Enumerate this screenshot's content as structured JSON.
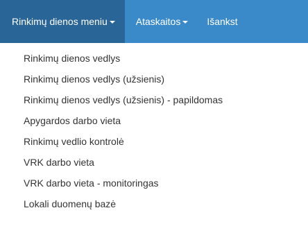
{
  "navbar": {
    "items": [
      {
        "label": "Rinkimų dienos meniu"
      },
      {
        "label": "Ataskaitos"
      },
      {
        "label": "Išankst"
      }
    ],
    "colors": {
      "background": "#3a8ac9",
      "active_background": "#2a6597",
      "text": "#ffffff"
    }
  },
  "dropdown": {
    "items": [
      {
        "label": "Rinkimų dienos vedlys"
      },
      {
        "label": "Rinkimų dienos vedlys (užsienis)"
      },
      {
        "label": "Rinkimų dienos vedlys (užsienis) - papildomas"
      },
      {
        "label": "Apygardos darbo vieta"
      },
      {
        "label": "Rinkimų vedlio kontrolė"
      },
      {
        "label": "VRK darbo vieta"
      },
      {
        "label": "VRK darbo vieta - monitoringas"
      },
      {
        "label": "Lokali duomenų bazė"
      }
    ]
  }
}
